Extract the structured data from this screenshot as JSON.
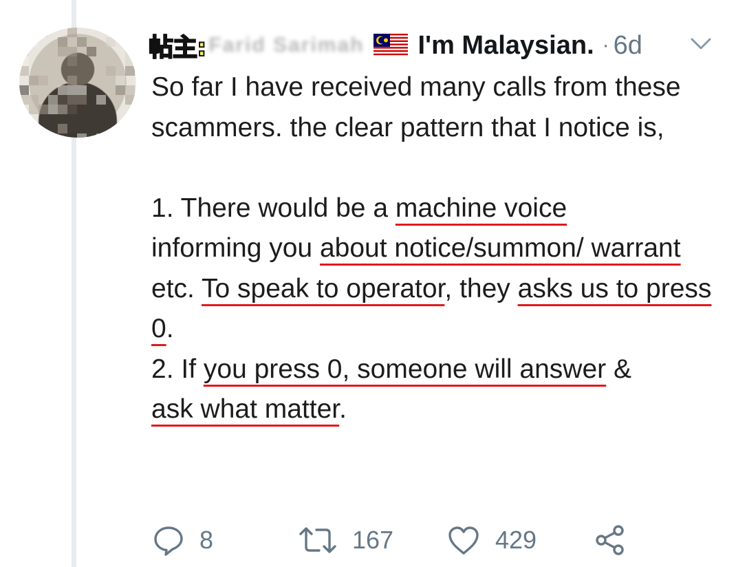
{
  "tweet": {
    "author_tag": "帖主:",
    "author_name_blurred": "Farid Sarimah",
    "flag_icon": "malaysia-flag-icon",
    "display_name": "I'm Malaysian.",
    "separator": "·",
    "timestamp": "6d",
    "lines": {
      "p1": "So far I have received many calls from these scammers. the clear pattern that I notice is,",
      "l1_prefix": "1. There would be a ",
      "l1_u1": "machine voice",
      "l1_mid": "informing you ",
      "l1_u2": "about notice/summon/ warrant",
      "l1_mid2": " etc. ",
      "l1_u3": "To speak to operator",
      "l1_mid3": ", they ",
      "l1_u4": "asks us to press 0",
      "l1_end": ".",
      "l2_prefix": "2. If ",
      "l2_u1": "you press 0, someone will answer",
      "l2_mid": " & ",
      "l2_u2": "ask what matter",
      "l2_end": "."
    },
    "underline_color": "#e0191e",
    "stats": {
      "replies": "8",
      "retweets": "167",
      "likes": "429"
    },
    "icons": {
      "reply": "reply-icon",
      "retweet": "retweet-icon",
      "like": "heart-icon",
      "share": "share-icon",
      "menu": "chevron-down-icon"
    }
  }
}
